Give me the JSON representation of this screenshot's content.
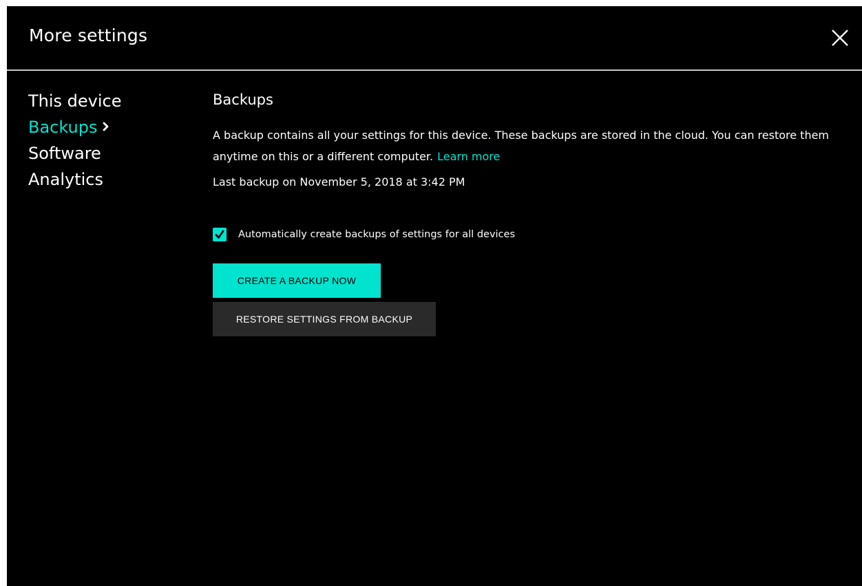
{
  "dialog": {
    "title": "More settings",
    "close_icon": "close-icon"
  },
  "nav": {
    "items": [
      {
        "label": "This device",
        "active": false
      },
      {
        "label": "Backups",
        "active": true
      },
      {
        "label": "Software",
        "active": false
      },
      {
        "label": "Analytics",
        "active": false
      }
    ],
    "active_indicator_icon": "chevron-right-icon"
  },
  "backups": {
    "title": "Backups",
    "description": "A backup contains all your settings for this device. These backups are stored in the cloud. You can restore them anytime on this or a different computer.",
    "learn_more": "Learn more",
    "last_backup": "Last backup on November 5, 2018 at 3:42 PM",
    "auto_backup": {
      "label": "Automatically create backups of settings for all devices",
      "checked": true
    },
    "create_button": "CREATE A BACKUP NOW",
    "restore_button": "RESTORE SETTINGS FROM BACKUP"
  },
  "colors": {
    "accent": "#00e3cf",
    "background": "#000000",
    "text": "#ffffff",
    "secondary_button": "#2a2a2a",
    "divider": "#c9c9c9"
  }
}
